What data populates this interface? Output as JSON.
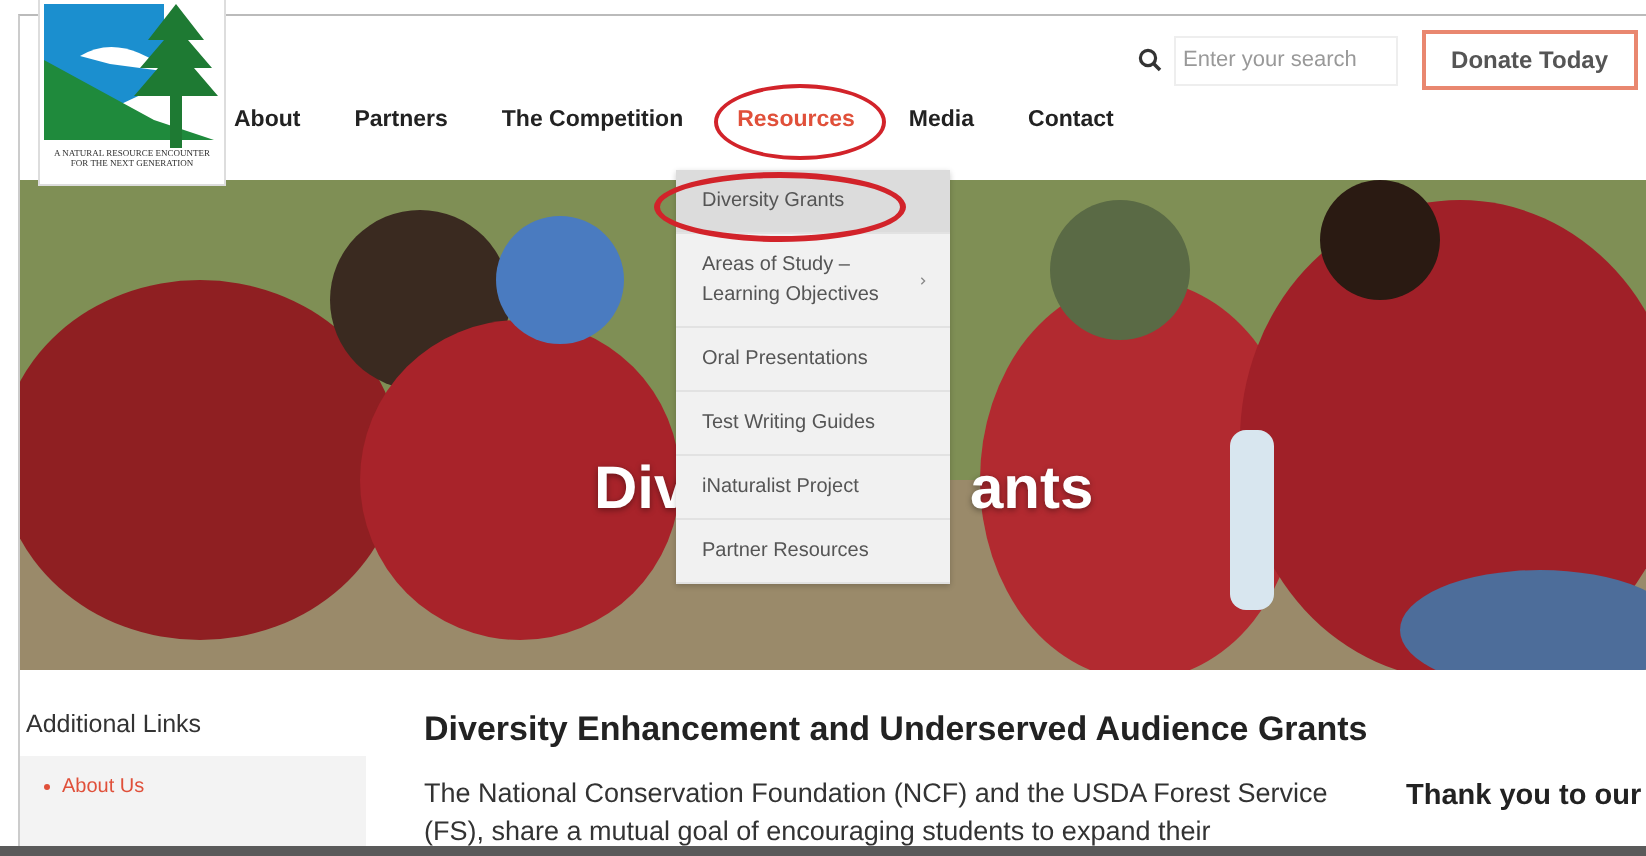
{
  "logo": {
    "caption": "A NATURAL RESOURCE ENCOUNTER FOR THE NEXT GENERATION"
  },
  "nav": [
    {
      "label": "About",
      "selected": false
    },
    {
      "label": "Partners",
      "selected": false
    },
    {
      "label": "The Competition",
      "selected": false
    },
    {
      "label": "Resources",
      "selected": true
    },
    {
      "label": "Media",
      "selected": false
    },
    {
      "label": "Contact",
      "selected": false
    }
  ],
  "search": {
    "placeholder": "Enter your search"
  },
  "donate_button": "Donate Today",
  "dropdown": [
    {
      "label": "Diversity Grants",
      "selected": true,
      "submenu": false
    },
    {
      "label": "Areas of Study – Learning Objectives",
      "selected": false,
      "submenu": true
    },
    {
      "label": "Oral Presentations",
      "selected": false,
      "submenu": false
    },
    {
      "label": "Test Writing Guides",
      "selected": false,
      "submenu": false
    },
    {
      "label": "iNaturalist Project",
      "selected": false,
      "submenu": false
    },
    {
      "label": "Partner Resources",
      "selected": false,
      "submenu": false
    }
  ],
  "hero": {
    "title_left": "Div",
    "title_right": "ants"
  },
  "sidebar": {
    "title": "Additional Links",
    "links": [
      "About Us"
    ]
  },
  "article": {
    "heading": "Diversity Enhancement and Underserved Audience Grants",
    "paragraph": "The National Conservation Foundation (NCF) and the USDA Forest Service",
    "paragraph_cut": "(FS), share a mutual goal of encouraging students to expand their"
  },
  "aside": {
    "title": "Thank you to our"
  }
}
